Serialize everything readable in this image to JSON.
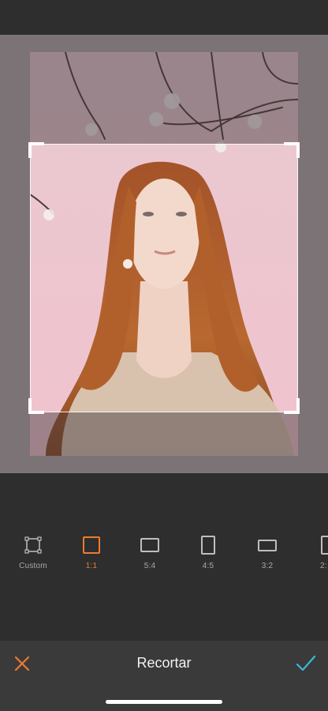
{
  "editor": {
    "title": "Recortar",
    "cancel_icon": "close-icon",
    "confirm_icon": "checkmark-icon",
    "accent_color": "#ee7a2c",
    "confirm_color": "#3bb8d8"
  },
  "aspect_ratios": {
    "selected": "1:1",
    "items": [
      {
        "label": "Custom",
        "icon": "custom-crop-icon"
      },
      {
        "label": "1:1",
        "icon": "square-ratio-icon"
      },
      {
        "label": "5:4",
        "icon": "landscape-5-4-icon"
      },
      {
        "label": "4:5",
        "icon": "portrait-4-5-icon"
      },
      {
        "label": "3:2",
        "icon": "landscape-3-2-icon"
      },
      {
        "label": "2:"
      }
    ]
  }
}
